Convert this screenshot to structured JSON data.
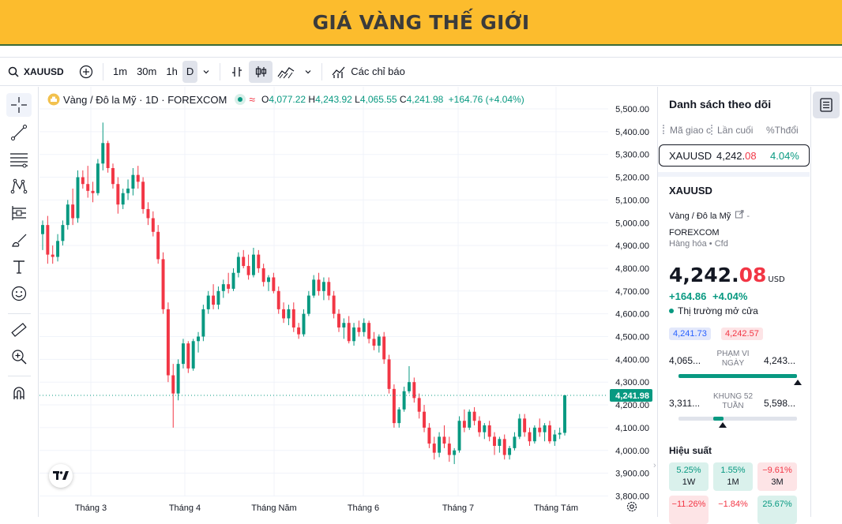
{
  "banner": {
    "title": "GIÁ VÀNG THẾ GIỚI"
  },
  "toolbar": {
    "symbol": "XAUUSD",
    "intervals": [
      "1m",
      "30m",
      "1h",
      "D"
    ],
    "active_interval": "D",
    "indicators_label": "Các chỉ báo"
  },
  "legend": {
    "name": "Vàng / Đô la Mỹ · 1D · FOREXCOM",
    "o_label": "O",
    "o_value": "4,077.22",
    "h_label": "H",
    "h_value": "4,243.92",
    "l_label": "L",
    "l_value": "4,065.55",
    "c_label": "C",
    "c_value": "4,241.98",
    "change": "+164.76 (+4.04%)"
  },
  "price_axis": {
    "ticks": [
      "5,500.00",
      "5,400.00",
      "5,300.00",
      "5,200.00",
      "5,100.00",
      "5,000.00",
      "4,900.00",
      "4,800.00",
      "4,700.00",
      "4,600.00",
      "4,500.00",
      "4,400.00",
      "4,300.00",
      "4,200.00",
      "4,100.00",
      "4,000.00",
      "3,900.00",
      "3,800.00"
    ],
    "current_price_label": "4,241.98"
  },
  "time_axis": {
    "ticks": [
      "Tháng 3",
      "Tháng 4",
      "Tháng Năm",
      "Tháng 6",
      "Tháng 7",
      "Tháng Tám"
    ]
  },
  "chart_data": {
    "type": "candlestick",
    "x": "daily candles, Feb to mid-Aug",
    "ylim": [
      3780,
      5540
    ],
    "grid": true,
    "last_close": 4241.98,
    "candles": [
      [
        4950,
        5010,
        4880,
        4990
      ],
      [
        4990,
        5030,
        4820,
        4860
      ],
      [
        4860,
        4900,
        4820,
        4850
      ],
      [
        4850,
        4950,
        4830,
        4920
      ],
      [
        4920,
        5010,
        4900,
        4990
      ],
      [
        4990,
        5100,
        4970,
        5080
      ],
      [
        5080,
        5150,
        4990,
        5020
      ],
      [
        5020,
        5230,
        5000,
        5200
      ],
      [
        5200,
        5230,
        5150,
        5170
      ],
      [
        5170,
        5250,
        5110,
        5140
      ],
      [
        5140,
        5180,
        5090,
        5130
      ],
      [
        5130,
        5280,
        5120,
        5260
      ],
      [
        5260,
        5440,
        5230,
        5350
      ],
      [
        5350,
        5360,
        5220,
        5240
      ],
      [
        5240,
        5260,
        5150,
        5170
      ],
      [
        5170,
        5200,
        5040,
        5080
      ],
      [
        5080,
        5150,
        5060,
        5130
      ],
      [
        5130,
        5190,
        5100,
        5150
      ],
      [
        5150,
        5240,
        5120,
        5210
      ],
      [
        5210,
        5250,
        5150,
        5180
      ],
      [
        5180,
        5200,
        5040,
        5060
      ],
      [
        5060,
        5090,
        4990,
        5020
      ],
      [
        5020,
        5050,
        4940,
        4960
      ],
      [
        4960,
        4990,
        4820,
        4840
      ],
      [
        4840,
        4870,
        4600,
        4620
      ],
      [
        4620,
        4650,
        4300,
        4330
      ],
      [
        4330,
        4380,
        4100,
        4250
      ],
      [
        4250,
        4400,
        4220,
        4380
      ],
      [
        4380,
        4490,
        4360,
        4470
      ],
      [
        4470,
        4480,
        4340,
        4360
      ],
      [
        4360,
        4490,
        4350,
        4480
      ],
      [
        4480,
        4520,
        4430,
        4500
      ],
      [
        4500,
        4640,
        4480,
        4620
      ],
      [
        4620,
        4700,
        4600,
        4680
      ],
      [
        4680,
        4730,
        4620,
        4640
      ],
      [
        4640,
        4720,
        4620,
        4700
      ],
      [
        4700,
        4750,
        4670,
        4730
      ],
      [
        4730,
        4780,
        4690,
        4710
      ],
      [
        4710,
        4800,
        4700,
        4780
      ],
      [
        4780,
        4870,
        4760,
        4850
      ],
      [
        4850,
        4880,
        4800,
        4810
      ],
      [
        4810,
        4860,
        4750,
        4770
      ],
      [
        4770,
        4890,
        4760,
        4860
      ],
      [
        4860,
        4880,
        4780,
        4800
      ],
      [
        4800,
        4820,
        4720,
        4740
      ],
      [
        4740,
        4770,
        4700,
        4760
      ],
      [
        4760,
        4780,
        4690,
        4700
      ],
      [
        4700,
        4720,
        4600,
        4620
      ],
      [
        4620,
        4650,
        4560,
        4580
      ],
      [
        4580,
        4640,
        4550,
        4620
      ],
      [
        4620,
        4650,
        4520,
        4540
      ],
      [
        4540,
        4560,
        4490,
        4510
      ],
      [
        4510,
        4620,
        4500,
        4600
      ],
      [
        4600,
        4700,
        4590,
        4680
      ],
      [
        4680,
        4770,
        4670,
        4750
      ],
      [
        4750,
        4780,
        4680,
        4700
      ],
      [
        4700,
        4760,
        4660,
        4740
      ],
      [
        4740,
        4760,
        4660,
        4680
      ],
      [
        4680,
        4700,
        4580,
        4600
      ],
      [
        4600,
        4620,
        4520,
        4540
      ],
      [
        4540,
        4580,
        4490,
        4560
      ],
      [
        4560,
        4590,
        4470,
        4480
      ],
      [
        4480,
        4560,
        4460,
        4540
      ],
      [
        4540,
        4570,
        4500,
        4520
      ],
      [
        4520,
        4580,
        4500,
        4560
      ],
      [
        4560,
        4570,
        4470,
        4490
      ],
      [
        4490,
        4520,
        4440,
        4460
      ],
      [
        4460,
        4510,
        4430,
        4500
      ],
      [
        4500,
        4520,
        4380,
        4400
      ],
      [
        4400,
        4420,
        4250,
        4270
      ],
      [
        4270,
        4290,
        4100,
        4120
      ],
      [
        4120,
        4190,
        4100,
        4180
      ],
      [
        4180,
        4280,
        4170,
        4260
      ],
      [
        4260,
        4370,
        4250,
        4300
      ],
      [
        4300,
        4320,
        4210,
        4230
      ],
      [
        4230,
        4250,
        4140,
        4170
      ],
      [
        4170,
        4200,
        4080,
        4100
      ],
      [
        4100,
        4120,
        4010,
        4030
      ],
      [
        4030,
        4060,
        3960,
        3990
      ],
      [
        3990,
        4080,
        3970,
        4060
      ],
      [
        4060,
        4110,
        4010,
        4030
      ],
      [
        4030,
        4060,
        3950,
        3980
      ],
      [
        3980,
        4010,
        3940,
        4000
      ],
      [
        4000,
        4150,
        3990,
        4130
      ],
      [
        4130,
        4180,
        4080,
        4100
      ],
      [
        4100,
        4180,
        4090,
        4170
      ],
      [
        4170,
        4190,
        4110,
        4130
      ],
      [
        4130,
        4150,
        4060,
        4080
      ],
      [
        4080,
        4120,
        4050,
        4110
      ],
      [
        4110,
        4130,
        4040,
        4060
      ],
      [
        4060,
        4080,
        3980,
        4020
      ],
      [
        4020,
        4060,
        3990,
        4050
      ],
      [
        4050,
        4070,
        3960,
        3980
      ],
      [
        3980,
        4020,
        3960,
        4010
      ],
      [
        4010,
        4080,
        4000,
        4060
      ],
      [
        4060,
        4160,
        4050,
        4140
      ],
      [
        4140,
        4160,
        4060,
        4080
      ],
      [
        4080,
        4100,
        4020,
        4040
      ],
      [
        4040,
        4110,
        4030,
        4100
      ],
      [
        4100,
        4140,
        4060,
        4080
      ],
      [
        4080,
        4120,
        4040,
        4110
      ],
      [
        4110,
        4130,
        4030,
        4040
      ],
      [
        4040,
        4090,
        4020,
        4070
      ],
      [
        4070,
        4100,
        4050,
        4077
      ],
      [
        4077.22,
        4243.92,
        4065.55,
        4241.98
      ]
    ],
    "colors": {
      "up": "#089981",
      "down": "#f23645"
    }
  },
  "watchlist": {
    "title": "Danh sách theo dõi",
    "col_symbol": "Mã giao c",
    "col_last": "Lần cuối",
    "col_change": "%Thđổi",
    "row": {
      "symbol": "XAUUSD",
      "last_main": "4,242.",
      "last_dec": "08",
      "change": "4.04%"
    }
  },
  "detail": {
    "symbol": "XAUUSD",
    "name": "Vàng / Đô la Mỹ",
    "exchange": "FOREXCOM",
    "type": "Hàng hóa",
    "sub": "Cfd",
    "price_main": "4,242.",
    "price_dec": "08",
    "currency": "USD",
    "change": "+164.86",
    "change_pct": "+4.04%",
    "market_status": "Thị trường mở cửa",
    "bid": "4,241.73",
    "ask": "4,242.57",
    "day_range_label": "PHẠM VI NGÀY",
    "day_low": "4,065...",
    "day_high": "4,243...",
    "week52_label": "KHUNG 52 TUẦN",
    "week52_low": "3,311...",
    "week52_high": "5,598...",
    "perf_title": "Hiệu suất",
    "perf": [
      {
        "value": "5.25%",
        "period": "1W",
        "up": true
      },
      {
        "value": "1.55%",
        "period": "1M",
        "up": true
      },
      {
        "value": "−9.61%",
        "period": "3M",
        "up": false
      },
      {
        "value": "−11.26%",
        "period": "",
        "up": false
      },
      {
        "value": "−1.84%",
        "period": "",
        "up": false
      },
      {
        "value": "25.67%",
        "period": "",
        "up": true
      }
    ]
  }
}
